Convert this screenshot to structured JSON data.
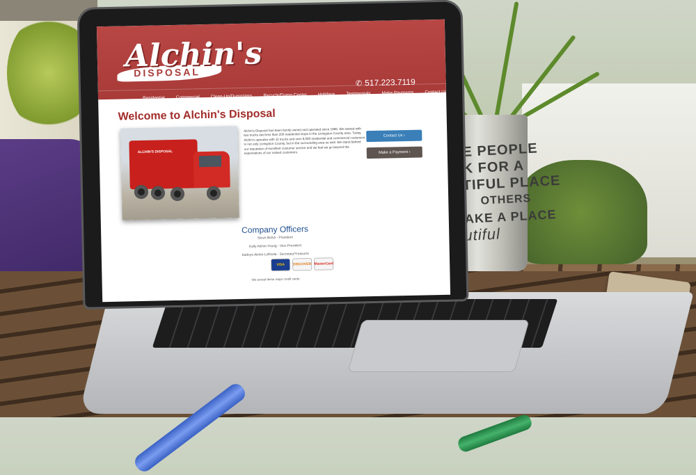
{
  "site": {
    "logo_text": "Alchin's",
    "logo_sub": "DISPOSAL",
    "phone": "517.223.7119",
    "phone_icon": "phone-icon",
    "accent_color": "#a83a38"
  },
  "nav": {
    "items": [
      "Residential",
      "Commercial",
      "Clean-Up/Dumpsters",
      "Recycle/Dump Center",
      "Holidays",
      "Testimonials",
      "Make Payments",
      "Contact Us"
    ]
  },
  "main": {
    "title": "Welcome to Alchin's Disposal",
    "intro": "Alchin's Disposal has been family owned and operated since 1986. We started with two trucks and less than 200 residential stops in the Livingston County area. Today, Alchin's operates with 11 trucks and over 8,000 residential and commercial customers in not only Livingston County, but in the surrounding area as well. We stand behind our reputation of excellent customer service and we feel we go beyond the expectations of our valued customers.",
    "contact_button": "Contact Us ›",
    "payment_button": "Make a Payment ›",
    "truck_label": "ALCHIN'S DISPOSAL"
  },
  "officers": {
    "title": "Company Officers",
    "list": [
      "Steve Alchin - President",
      "Kelly Alchin-Young - Vice-President",
      "Kathryn Alchin-Loffreda - Secretary/Treasurer"
    ]
  },
  "payment_cards": {
    "visa": "VISA",
    "discover": "DISCOVER",
    "mastercard": "MasterCard",
    "note": "We accept these major credit cards."
  },
  "pot_text": [
    "ME PEOPLE",
    "OK FOR A",
    "UTIFUL PLACE",
    "OTHERS",
    "MAKE A PLACE",
    "autiful"
  ]
}
